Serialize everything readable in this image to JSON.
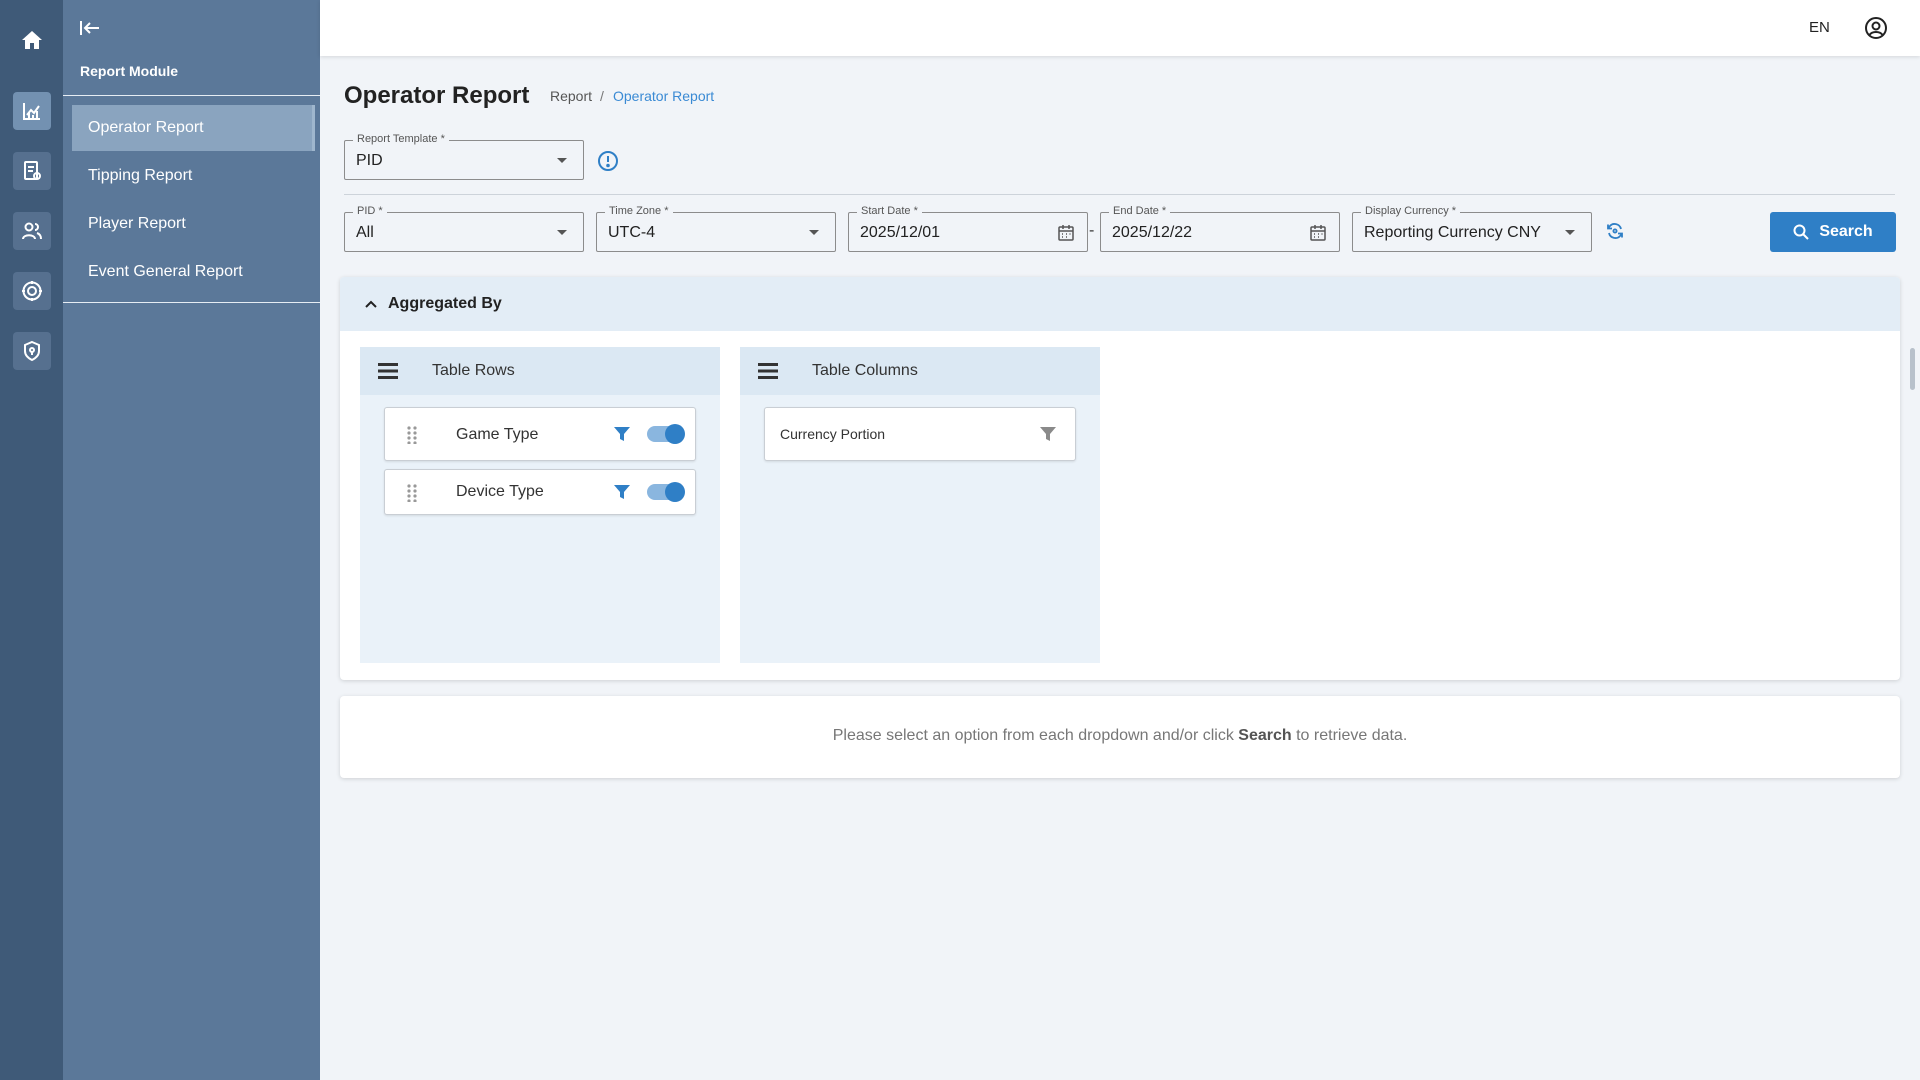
{
  "rail": {
    "items": [
      {
        "icon": "home-icon"
      },
      {
        "icon": "chart-icon"
      },
      {
        "icon": "report-document-icon"
      },
      {
        "icon": "users-icon"
      },
      {
        "icon": "target-icon"
      },
      {
        "icon": "shield-icon"
      }
    ]
  },
  "sidebar": {
    "module_title": "Report Module",
    "items": [
      {
        "label": "Operator Report",
        "active": true
      },
      {
        "label": "Tipping Report"
      },
      {
        "label": "Player Report"
      },
      {
        "label": "Event General Report"
      }
    ]
  },
  "topbar": {
    "language": "EN"
  },
  "page": {
    "title": "Operator Report",
    "breadcrumb": [
      "Report",
      "/",
      "Operator Report"
    ]
  },
  "template_field": {
    "label": "Report Template *",
    "value": "PID"
  },
  "filters": {
    "pid": {
      "label": "PID *",
      "value": "All"
    },
    "time_zone": {
      "label": "Time Zone *",
      "value": "UTC-4"
    },
    "start_date": {
      "label": "Start Date *",
      "value": "2025/12/01"
    },
    "date_separator": "-",
    "end_date": {
      "label": "End Date *",
      "value": "2025/12/22"
    },
    "currency": {
      "label": "Display Currency *",
      "value": "Reporting Currency CNY"
    },
    "search_label": "Search"
  },
  "aggregated": {
    "title": "Aggregated By",
    "rows_title": "Table Rows",
    "rows": [
      {
        "label": "Game Type",
        "enabled": true
      },
      {
        "label": "Device Type",
        "enabled": true
      }
    ],
    "columns_title": "Table Columns",
    "columns": [
      {
        "label": "Currency Portion"
      }
    ]
  },
  "empty_state": {
    "before": "Please select an option from each dropdown and/or click ",
    "bold": "Search",
    "after": " to retrieve data."
  },
  "colors": {
    "rail": "#3f5a78",
    "sidebar": "#5b7899",
    "accent": "#2f7fc6",
    "panel_header": "#e3edf6"
  }
}
